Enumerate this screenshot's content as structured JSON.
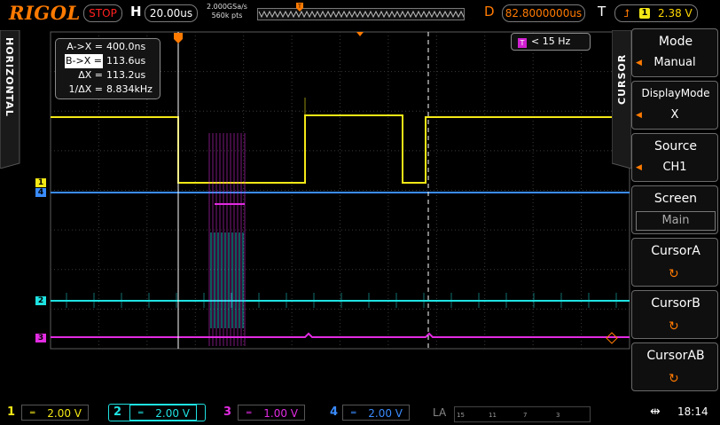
{
  "header": {
    "brand": "RIGOL",
    "run_state": "STOP",
    "h_label": "H",
    "timebase": "20.00us",
    "sample_rate": "2.000GSa/s",
    "memory_depth": "560k pts",
    "d_label": "D",
    "delay": "82.8000000us",
    "t_label": "T",
    "trigger_source": "1",
    "trigger_level": "2.38 V"
  },
  "side_labels": {
    "left": "HORIZONTAL",
    "right": "CURSOR"
  },
  "cursor_readout": {
    "rows": [
      {
        "key": "A->X =",
        "value": "400.0ns",
        "selected": false
      },
      {
        "key": "B->X =",
        "value": "113.6us",
        "selected": true
      },
      {
        "key": "ΔX =",
        "value": "113.2us",
        "selected": false
      },
      {
        "key": "1/ΔX =",
        "value": "8.834kHz",
        "selected": false
      }
    ]
  },
  "frequency_counter": {
    "icon": "T",
    "value": "< 15 Hz"
  },
  "menu": {
    "items": [
      {
        "title": "Mode",
        "sub": "Manual"
      },
      {
        "title": "DisplayMode",
        "sub": "X"
      },
      {
        "title": "Source",
        "sub": "CH1"
      },
      {
        "title": "Screen",
        "sub": "Main"
      },
      {
        "title": "CursorA",
        "sub": ""
      },
      {
        "title": "CursorB",
        "sub": ""
      },
      {
        "title": "CursorAB",
        "sub": ""
      }
    ]
  },
  "channels": [
    {
      "num": "1",
      "scale": "2.00 V",
      "color": "#f4e816"
    },
    {
      "num": "2",
      "scale": "2.00 V",
      "color": "#1fe2e2"
    },
    {
      "num": "3",
      "scale": "1.00 V",
      "color": "#e22be2"
    },
    {
      "num": "4",
      "scale": "2.00 V",
      "color": "#3a8cff"
    }
  ],
  "trace_markers": [
    {
      "label": "1",
      "color": "#f4e816"
    },
    {
      "label": "4",
      "color": "#3a8cff"
    },
    {
      "label": "2",
      "color": "#1fe2e2"
    },
    {
      "label": "3",
      "color": "#e22be2"
    }
  ],
  "logic_analyzer": {
    "label": "LA",
    "groups": [
      "15",
      "11",
      "7",
      "3"
    ]
  },
  "status": {
    "usb_icon": "usb-icon",
    "time": "18:14"
  },
  "colors": {
    "accent": "#ff7a00",
    "grid": "#3a3a3a",
    "ch1": "#f4e816",
    "ch2": "#1fe2e2",
    "ch3": "#e22be2",
    "ch4": "#3a8cff"
  }
}
